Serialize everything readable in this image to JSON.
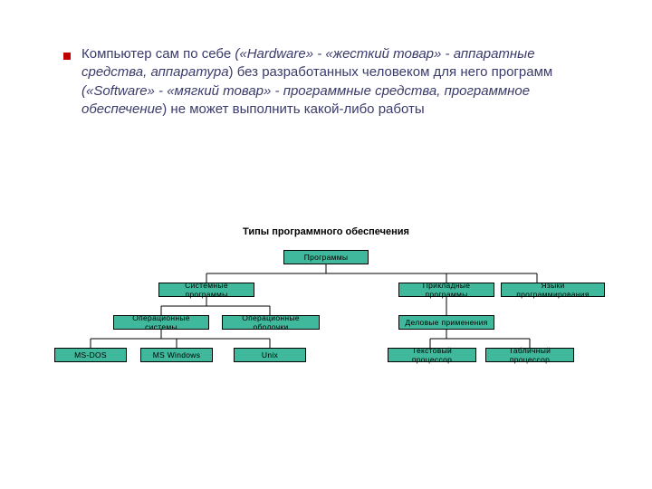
{
  "headline": {
    "p1": "Компьютер сам по себе ",
    "p2": "(«Hardware» - «жесткий товар» - аппаратные средства, аппаратура",
    "p3": ") без разработанных человеком для него программ ",
    "p4": "(«Software» - «мягкий товар» - программные средства, программное обеспечение",
    "p5": ") не может выполнить какой-либо работы"
  },
  "diagram": {
    "title": "Типы программного обеспечения",
    "root": "Программы",
    "level1": {
      "sys": "Системные программы",
      "app": "Прикладные программы",
      "lang": "Языки программирования"
    },
    "level2": {
      "os": "Операционные системы",
      "shell": "Операционные оболочки",
      "business": "Деловые применения"
    },
    "level3": {
      "msdos": "MS-DOS",
      "mswin": "MS Windows",
      "unix": "Unix",
      "textproc": "Текстовый процессор",
      "tableproc": "Табличный процессор"
    }
  },
  "colors": {
    "node_bg": "#3fb89b",
    "bullet": "#c00000",
    "headline": "#3b3b6b"
  }
}
